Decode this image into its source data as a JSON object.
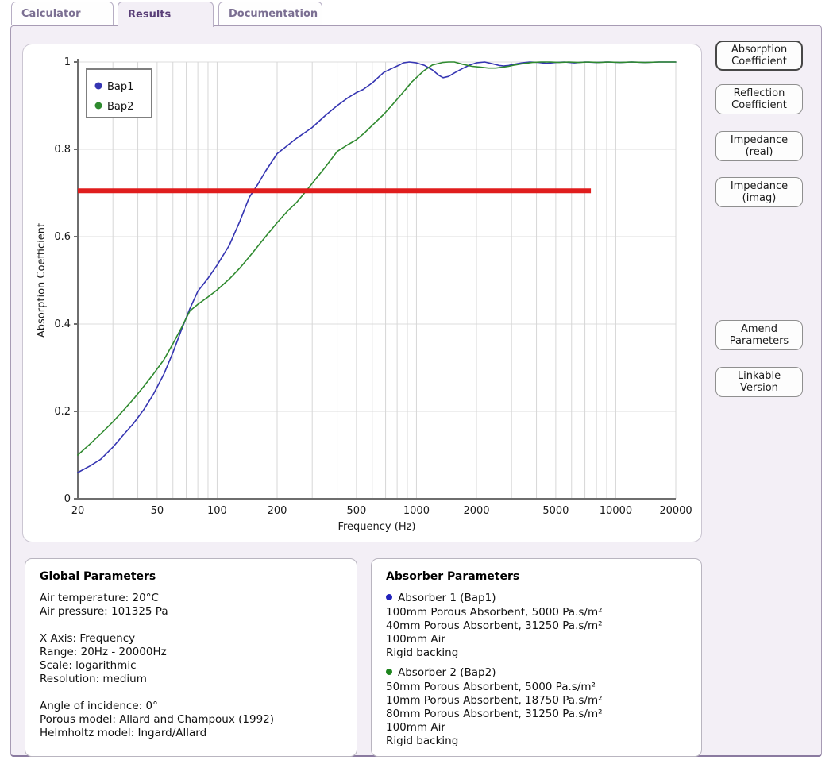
{
  "tabs": [
    {
      "label": "Calculator",
      "active": false
    },
    {
      "label": "Results",
      "active": true
    },
    {
      "label": "Documentation",
      "active": false
    }
  ],
  "side_buttons": [
    {
      "label": "Absorption Coefficient",
      "active": true
    },
    {
      "label": "Reflection Coefficient",
      "active": false
    },
    {
      "label": "Impedance (real)",
      "active": false
    },
    {
      "label": "Impedance (imag)",
      "active": false
    }
  ],
  "action_buttons": [
    {
      "label": "Amend Parameters"
    },
    {
      "label": "Linkable Version"
    }
  ],
  "global_parameters": {
    "title": "Global Parameters",
    "lines": [
      "Air temperature: 20°C",
      "Air pressure: 101325 Pa",
      "",
      "X Axis: Frequency",
      "Range: 20Hz - 20000Hz",
      "Scale: logarithmic",
      "Resolution: medium",
      "",
      "Angle of incidence: 0°",
      "Porous model: Allard and Champoux (1992)",
      "Helmholtz model: Ingard/Allard"
    ]
  },
  "absorber_parameters": {
    "title": "Absorber Parameters",
    "absorbers": [
      {
        "name": "Absorber 1 (Bap1)",
        "color": "#2222bb",
        "layers": [
          "100mm Porous Absorbent, 5000 Pa.s/m²",
          "40mm Porous Absorbent, 31250 Pa.s/m²",
          "100mm Air",
          "Rigid backing"
        ]
      },
      {
        "name": "Absorber 2 (Bap2)",
        "color": "#1e851e",
        "layers": [
          "50mm Porous Absorbent, 5000 Pa.s/m²",
          "10mm Porous Absorbent, 18750 Pa.s/m²",
          "80mm Porous Absorbent, 31250 Pa.s/m²",
          "100mm Air",
          "Rigid backing"
        ]
      }
    ]
  },
  "chart_data": {
    "type": "line",
    "title": "",
    "xlabel": "Frequency (Hz)",
    "ylabel": "Absorption Coefficient",
    "x_scale": "log",
    "xlim": [
      20,
      20000
    ],
    "ylim": [
      0,
      1
    ],
    "x_ticks": [
      20,
      50,
      100,
      200,
      500,
      1000,
      2000,
      5000,
      10000,
      20000
    ],
    "y_ticks": [
      0,
      0.2,
      0.4,
      0.6,
      0.8,
      1
    ],
    "grid": true,
    "legend_position": "top-left",
    "series": [
      {
        "name": "Bap1",
        "color": "#3535b2",
        "points": [
          [
            20,
            0.06
          ],
          [
            23,
            0.075
          ],
          [
            26,
            0.09
          ],
          [
            30,
            0.118
          ],
          [
            34,
            0.147
          ],
          [
            38,
            0.172
          ],
          [
            43,
            0.205
          ],
          [
            48,
            0.24
          ],
          [
            54,
            0.285
          ],
          [
            60,
            0.335
          ],
          [
            66,
            0.385
          ],
          [
            73,
            0.435
          ],
          [
            80,
            0.475
          ],
          [
            90,
            0.505
          ],
          [
            100,
            0.535
          ],
          [
            115,
            0.58
          ],
          [
            130,
            0.635
          ],
          [
            145,
            0.69
          ],
          [
            160,
            0.72
          ],
          [
            175,
            0.75
          ],
          [
            200,
            0.79
          ],
          [
            220,
            0.805
          ],
          [
            250,
            0.825
          ],
          [
            300,
            0.85
          ],
          [
            350,
            0.878
          ],
          [
            400,
            0.9
          ],
          [
            450,
            0.917
          ],
          [
            500,
            0.93
          ],
          [
            540,
            0.937
          ],
          [
            600,
            0.952
          ],
          [
            685,
            0.976
          ],
          [
            750,
            0.985
          ],
          [
            820,
            0.993
          ],
          [
            860,
            0.998
          ],
          [
            920,
            1.0
          ],
          [
            1000,
            0.998
          ],
          [
            1100,
            0.992
          ],
          [
            1200,
            0.982
          ],
          [
            1300,
            0.969
          ],
          [
            1360,
            0.964
          ],
          [
            1450,
            0.967
          ],
          [
            1550,
            0.975
          ],
          [
            1700,
            0.985
          ],
          [
            1850,
            0.993
          ],
          [
            2000,
            0.998
          ],
          [
            2200,
            1.0
          ],
          [
            2400,
            0.996
          ],
          [
            2600,
            0.992
          ],
          [
            2750,
            0.991
          ],
          [
            2900,
            0.992
          ],
          [
            3100,
            0.995
          ],
          [
            3400,
            0.998
          ],
          [
            3700,
            1.0
          ],
          [
            4100,
            0.999
          ],
          [
            4500,
            0.997
          ],
          [
            5000,
            0.999
          ],
          [
            5500,
            1.0
          ],
          [
            6200,
            0.998
          ],
          [
            7000,
            1.0
          ],
          [
            8000,
            0.999
          ],
          [
            9000,
            1.0
          ],
          [
            10500,
            0.999
          ],
          [
            12000,
            1.0
          ],
          [
            14000,
            0.999
          ],
          [
            16500,
            1.0
          ],
          [
            20000,
            1.0
          ]
        ]
      },
      {
        "name": "Bap2",
        "color": "#2f8a2f",
        "points": [
          [
            20,
            0.1
          ],
          [
            23,
            0.125
          ],
          [
            26,
            0.148
          ],
          [
            30,
            0.176
          ],
          [
            34,
            0.203
          ],
          [
            38,
            0.228
          ],
          [
            43,
            0.258
          ],
          [
            48,
            0.286
          ],
          [
            54,
            0.318
          ],
          [
            60,
            0.355
          ],
          [
            66,
            0.39
          ],
          [
            73,
            0.43
          ],
          [
            80,
            0.445
          ],
          [
            90,
            0.462
          ],
          [
            100,
            0.478
          ],
          [
            115,
            0.503
          ],
          [
            130,
            0.528
          ],
          [
            150,
            0.562
          ],
          [
            175,
            0.6
          ],
          [
            200,
            0.632
          ],
          [
            225,
            0.658
          ],
          [
            250,
            0.678
          ],
          [
            280,
            0.705
          ],
          [
            300,
            0.722
          ],
          [
            350,
            0.76
          ],
          [
            400,
            0.795
          ],
          [
            450,
            0.81
          ],
          [
            500,
            0.822
          ],
          [
            550,
            0.838
          ],
          [
            600,
            0.855
          ],
          [
            685,
            0.88
          ],
          [
            750,
            0.9
          ],
          [
            855,
            0.93
          ],
          [
            950,
            0.955
          ],
          [
            1090,
            0.98
          ],
          [
            1200,
            0.993
          ],
          [
            1350,
            0.999
          ],
          [
            1450,
            1.0
          ],
          [
            1550,
            1.0
          ],
          [
            1700,
            0.995
          ],
          [
            1900,
            0.99
          ],
          [
            2100,
            0.988
          ],
          [
            2300,
            0.986
          ],
          [
            2500,
            0.986
          ],
          [
            2700,
            0.988
          ],
          [
            2900,
            0.99
          ],
          [
            3100,
            0.993
          ],
          [
            3400,
            0.996
          ],
          [
            3800,
            0.999
          ],
          [
            4200,
            1.0
          ],
          [
            4700,
            1.0
          ],
          [
            5200,
            0.999
          ],
          [
            5800,
            1.0
          ],
          [
            6500,
            0.999
          ],
          [
            7300,
            1.0
          ],
          [
            8200,
            0.999
          ],
          [
            9200,
            1.0
          ],
          [
            10500,
            0.999
          ],
          [
            12000,
            1.0
          ],
          [
            14000,
            0.999
          ],
          [
            16500,
            1.0
          ],
          [
            20000,
            1.0
          ]
        ]
      }
    ],
    "threshold_line": {
      "value": 0.705,
      "x_start": 20,
      "x_end": 7500,
      "color": "#e01d1d",
      "width": 6
    }
  }
}
